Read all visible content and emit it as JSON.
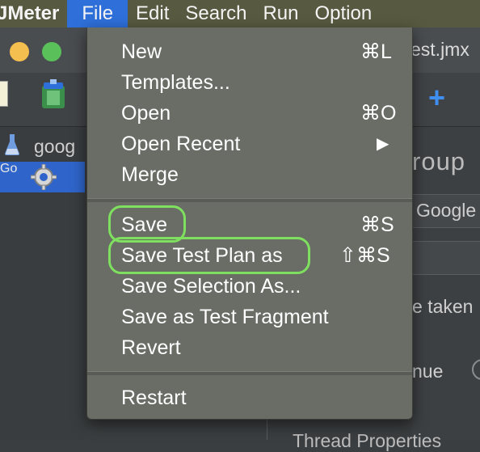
{
  "menubar": {
    "app": "JMeter",
    "items": [
      "File",
      "Edit",
      "Search",
      "Run",
      "Option"
    ]
  },
  "window": {
    "title": "est.jmx"
  },
  "tree": {
    "root_label": "goog",
    "child_label": "Go"
  },
  "content": {
    "heading": "roup",
    "field_value": "Google",
    "taken_label": "e taken",
    "continue_label": "nue",
    "bottom_label": "Thread Properties"
  },
  "file_menu": {
    "items": [
      {
        "label": "New",
        "shortcut": "⌘L"
      },
      {
        "label": "Templates...",
        "shortcut": ""
      },
      {
        "label": "Open",
        "shortcut": "⌘O"
      },
      {
        "label": "Open Recent",
        "shortcut": "▶"
      },
      {
        "label": "Merge",
        "shortcut": ""
      },
      {
        "label": "Save",
        "shortcut": "⌘S"
      },
      {
        "label": "Save Test Plan as",
        "shortcut": "⇧⌘S"
      },
      {
        "label": "Save Selection As...",
        "shortcut": ""
      },
      {
        "label": "Save as Test Fragment",
        "shortcut": ""
      },
      {
        "label": "Revert",
        "shortcut": ""
      },
      {
        "label": "Restart",
        "shortcut": ""
      }
    ]
  },
  "colors": {
    "menubar": "#575a40",
    "active_menu": "#2e6fd9",
    "menu_bg": "#6a6c66",
    "highlight_outline": "#7ee05e",
    "tree_selection": "#2f65ca"
  }
}
